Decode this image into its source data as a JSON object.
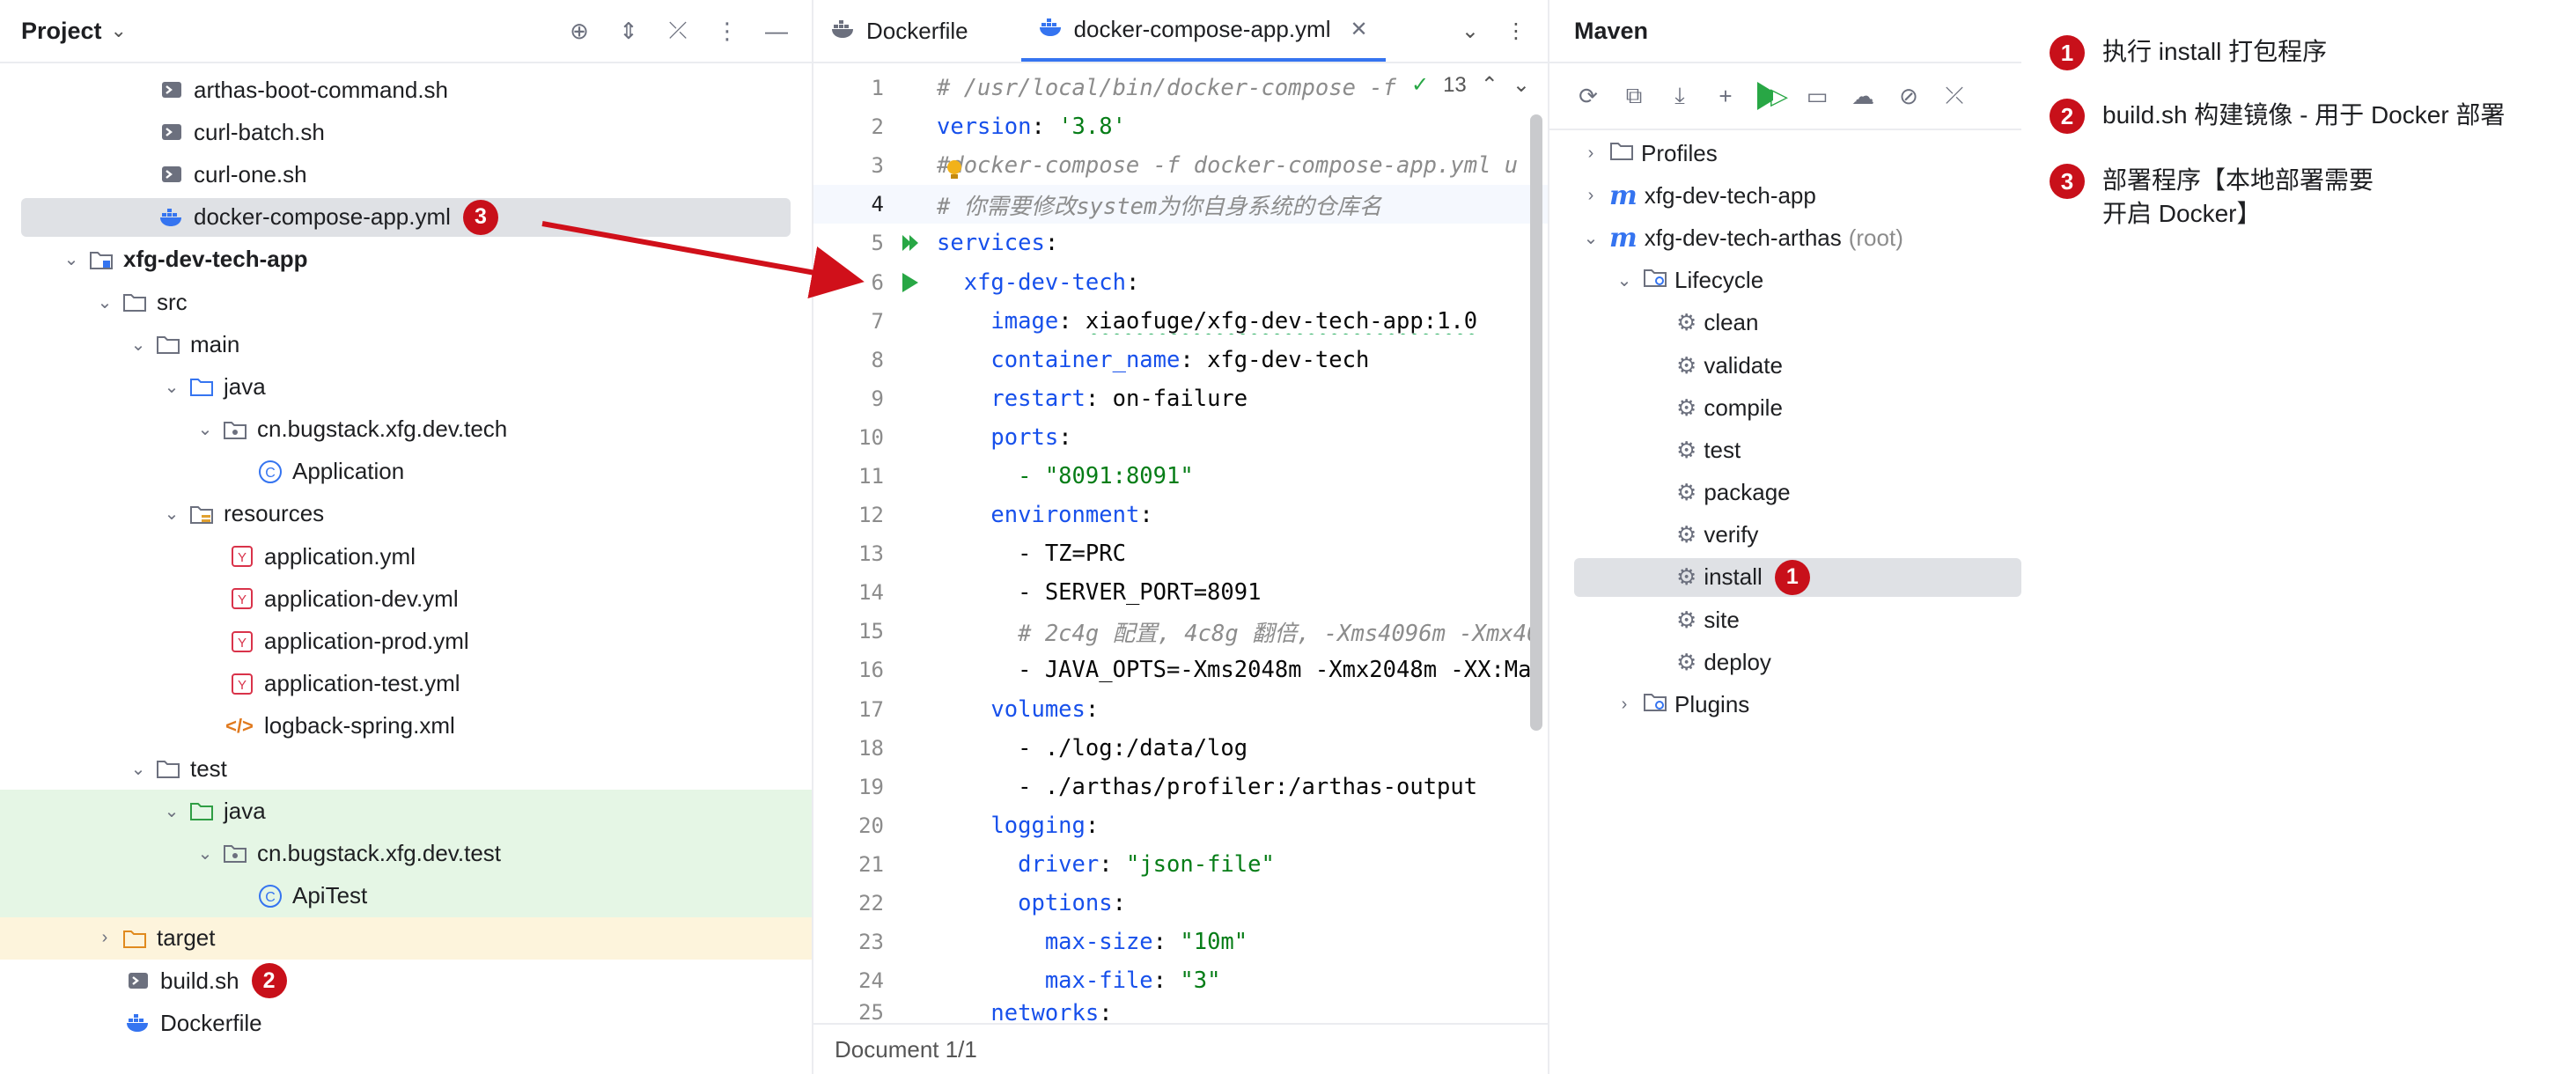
{
  "project_panel": {
    "title": "Project",
    "tree": [
      {
        "label": "arthas-boot-command.sh",
        "icon": "shell-script-icon"
      },
      {
        "label": "curl-batch.sh",
        "icon": "shell-script-icon"
      },
      {
        "label": "curl-one.sh",
        "icon": "shell-script-icon"
      },
      {
        "label": "docker-compose-app.yml",
        "icon": "docker-icon",
        "badge": "3"
      },
      {
        "label": "xfg-dev-tech-app",
        "icon": "module-folder-icon"
      },
      {
        "label": "src",
        "icon": "folder-icon"
      },
      {
        "label": "main",
        "icon": "folder-icon"
      },
      {
        "label": "java",
        "icon": "source-folder-icon"
      },
      {
        "label": "cn.bugstack.xfg.dev.tech",
        "icon": "package-icon"
      },
      {
        "label": "Application",
        "icon": "class-icon"
      },
      {
        "label": "resources",
        "icon": "resources-folder-icon"
      },
      {
        "label": "application.yml",
        "icon": "yaml-icon"
      },
      {
        "label": "application-dev.yml",
        "icon": "yaml-icon"
      },
      {
        "label": "application-prod.yml",
        "icon": "yaml-icon"
      },
      {
        "label": "application-test.yml",
        "icon": "yaml-icon"
      },
      {
        "label": "logback-spring.xml",
        "icon": "xml-icon"
      },
      {
        "label": "test",
        "icon": "folder-icon"
      },
      {
        "label": "java",
        "icon": "test-source-folder-icon"
      },
      {
        "label": "cn.bugstack.xfg.dev.test",
        "icon": "package-icon"
      },
      {
        "label": "ApiTest",
        "icon": "class-icon"
      },
      {
        "label": "target",
        "icon": "excluded-folder-icon"
      },
      {
        "label": "build.sh",
        "icon": "shell-script-icon",
        "badge": "2"
      },
      {
        "label": "Dockerfile",
        "icon": "docker-icon"
      }
    ]
  },
  "editor": {
    "tabs": [
      {
        "label": "Dockerfile",
        "active": false
      },
      {
        "label": "docker-compose-app.yml",
        "active": true
      }
    ],
    "inspection_count": "13",
    "status": "Document 1/1",
    "lines": [
      {
        "n": "1",
        "text": "# /usr/local/bin/docker-compose -f"
      },
      {
        "n": "2",
        "key": "version",
        "val": "'3.8'"
      },
      {
        "n": "3",
        "text": "#docker-compose -f docker-compose-app.yml u"
      },
      {
        "n": "4",
        "text": "# 你需要修改system为你自身系统的仓库名"
      },
      {
        "n": "5",
        "key": "services",
        "val": ""
      },
      {
        "n": "6",
        "key": "xfg-dev-tech",
        "val": ""
      },
      {
        "n": "7",
        "key": "image",
        "val": "xiaofuge/xfg-dev-tech-app:1.0"
      },
      {
        "n": "8",
        "key": "container_name",
        "val": "xfg-dev-tech"
      },
      {
        "n": "9",
        "key": "restart",
        "val": "on-failure"
      },
      {
        "n": "10",
        "key": "ports",
        "val": ""
      },
      {
        "n": "11",
        "text": "- \"8091:8091\""
      },
      {
        "n": "12",
        "key": "environment",
        "val": ""
      },
      {
        "n": "13",
        "text": "- TZ=PRC"
      },
      {
        "n": "14",
        "text": "- SERVER_PORT=8091"
      },
      {
        "n": "15",
        "text": "# 2c4g 配置, 4c8g 翻倍, -Xms4096m -Xmx40"
      },
      {
        "n": "16",
        "text": "- JAVA_OPTS=-Xms2048m -Xmx2048m -XX:Ma"
      },
      {
        "n": "17",
        "key": "volumes",
        "val": ""
      },
      {
        "n": "18",
        "text": "- ./log:/data/log"
      },
      {
        "n": "19",
        "text": "- ./arthas/profiler:/arthas-output"
      },
      {
        "n": "20",
        "key": "logging",
        "val": ""
      },
      {
        "n": "21",
        "key": "driver",
        "val": "\"json-file\""
      },
      {
        "n": "22",
        "key": "options",
        "val": ""
      },
      {
        "n": "23",
        "key": "max-size",
        "val": "\"10m\""
      },
      {
        "n": "24",
        "key": "max-file",
        "val": "\"3\""
      },
      {
        "n": "25",
        "key": "networks",
        "val": ""
      }
    ]
  },
  "maven": {
    "title": "Maven",
    "tree": [
      {
        "label": "Profiles",
        "icon": "folder-icon"
      },
      {
        "label": "xfg-dev-tech-app",
        "icon": "maven-icon"
      },
      {
        "label": "xfg-dev-tech-arthas",
        "suffix": "(root)",
        "icon": "maven-icon"
      },
      {
        "label": "Lifecycle",
        "icon": "folder-icon"
      },
      {
        "label": "clean",
        "icon": "gear-icon"
      },
      {
        "label": "validate",
        "icon": "gear-icon"
      },
      {
        "label": "compile",
        "icon": "gear-icon"
      },
      {
        "label": "test",
        "icon": "gear-icon"
      },
      {
        "label": "package",
        "icon": "gear-icon"
      },
      {
        "label": "verify",
        "icon": "gear-icon"
      },
      {
        "label": "install",
        "icon": "gear-icon",
        "badge": "1"
      },
      {
        "label": "site",
        "icon": "gear-icon"
      },
      {
        "label": "deploy",
        "icon": "gear-icon"
      },
      {
        "label": "Plugins",
        "icon": "folder-icon"
      }
    ]
  },
  "notes": [
    {
      "num": "1",
      "text": "执行 install 打包程序"
    },
    {
      "num": "2",
      "text": "build.sh 构建镜像 - 用于 Docker 部署"
    },
    {
      "num": "3",
      "line1": "部署程序【本地部署需要",
      "line2": "开启 Docker】"
    }
  ],
  "colors": {
    "accent": "#3574f0",
    "badge": "#c8101a",
    "selection": "#dfe1e5",
    "arrow": "#d0101a"
  }
}
